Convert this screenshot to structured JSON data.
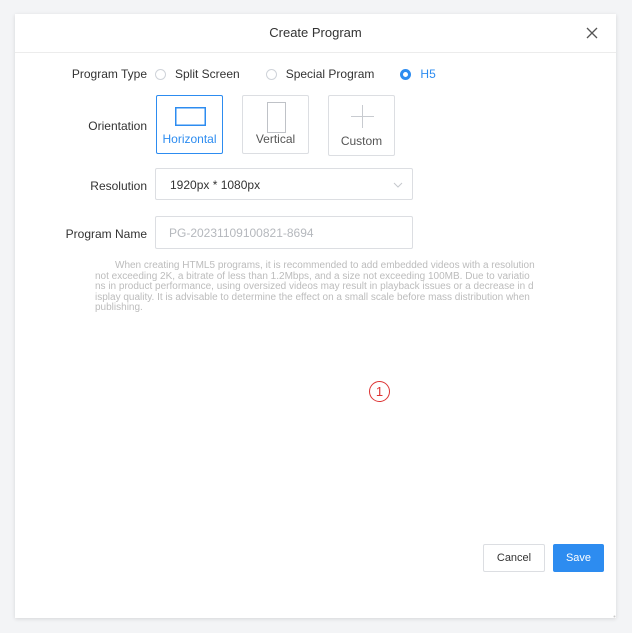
{
  "dialog": {
    "title": "Create Program",
    "close_icon": "close-icon"
  },
  "form": {
    "program_type": {
      "label": "Program Type",
      "options": [
        "Split Screen",
        "Special Program",
        "H5"
      ],
      "selected": "H5"
    },
    "orientation": {
      "label": "Orientation",
      "options": [
        {
          "label": "Horizontal",
          "icon": "horizontal-rect-icon"
        },
        {
          "label": "Vertical",
          "icon": "vertical-rect-icon"
        },
        {
          "label": "Custom",
          "icon": "plus-icon"
        }
      ],
      "selected": "Horizontal"
    },
    "resolution": {
      "label": "Resolution",
      "value": "1920px * 1080px",
      "icon": "chevron-down-icon"
    },
    "program_name": {
      "label": "Program Name",
      "placeholder": "PG-20231109100821-8694"
    },
    "hint": "When creating HTML5 programs, it is recommended to add embedded videos with a resolution not exceeding 2K, a bitrate of less than 1.2Mbps, and a size not exceeding 100MB. Due to variations in product performance, using oversized videos may result in playback issues or a decrease in display quality. It is advisable to determine the effect on a small scale before mass distribution when publishing."
  },
  "annotation": {
    "marker": "1"
  },
  "footer": {
    "cancel_label": "Cancel",
    "save_label": "Save"
  },
  "colors": {
    "accent": "#2d8cf0",
    "border": "#dcdee2",
    "hint_text": "#bcbcbc",
    "marker": "#dd3333"
  }
}
